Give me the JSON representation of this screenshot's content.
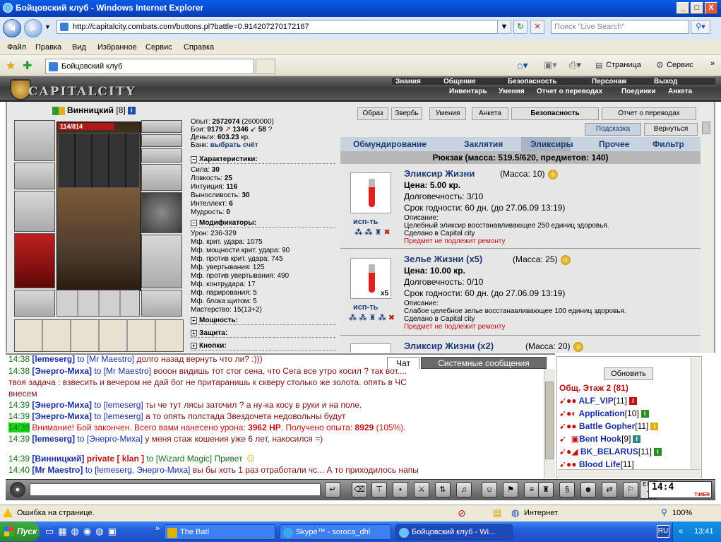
{
  "window": {
    "title": "Бойцовский клуб - Windows Internet Explorer",
    "min": "_",
    "max": "□",
    "close": "X"
  },
  "address": {
    "url": "http://capitalcity.combats.com/buttons.pl?battle=0.914207270172167",
    "search_placeholder": "Поиск \"Live Search\""
  },
  "menu": [
    "Файл",
    "Правка",
    "Вид",
    "Избранное",
    "Сервис",
    "Справка"
  ],
  "fav": {
    "tab": "Бойцовский клуб",
    "page": "Страница",
    "tools": "Сервис"
  },
  "game": {
    "logo": "CAPITALCITY",
    "nav_top": [
      "Знания",
      "Общение",
      "Безопасность",
      "Персонаж",
      "Выход"
    ],
    "nav_bottom": [
      "Инвентарь",
      "Умения",
      "Отчет о переводах",
      "Поединки",
      "Анкета"
    ]
  },
  "character": {
    "name": "Винницкий",
    "level": "[8]",
    "hp": "114/814",
    "info": [
      {
        "label": "Опыт:",
        "value": "2572074",
        "extra": "(2600000)"
      },
      {
        "label": "Бои:",
        "value": "9179",
        "extra": "1346",
        "extra2": "58"
      },
      {
        "label": "Деньги:",
        "value": "603.23",
        "extra": "кр."
      },
      {
        "label": "Банк:",
        "value": "выбрать счёт",
        "extra": ""
      }
    ],
    "sections": {
      "stats": "Характеристики:",
      "mods": "Модификаторы:",
      "power": "Мощность:",
      "defense": "Защита:",
      "buttons": "Кнопки:"
    },
    "stats": [
      {
        "label": "Сила:",
        "value": "30"
      },
      {
        "label": "Ловкость:",
        "value": "25"
      },
      {
        "label": "Интуиция:",
        "value": "116"
      },
      {
        "label": "Выносливость:",
        "value": "30"
      },
      {
        "label": "Интеллект:",
        "value": "6"
      },
      {
        "label": "Мудрость:",
        "value": "0"
      }
    ],
    "mods": [
      "Урон: 236-329",
      "Мф. крит. удара: 1075",
      "Мф. мощности крит. удара: 90",
      "Мф. против крит. удара: 745",
      "Мф. увертывания: 125",
      "Мф. против увертывания: 490",
      "Мф. контрудара: 17",
      "Мф. парирования: 5",
      "Мф. блока щитом: 5",
      "Мастерство: 15(13+2)"
    ]
  },
  "panel": {
    "top_buttons": [
      "Образ",
      "Звербь",
      "Умения",
      "Анкета",
      "Безопасность",
      "Отчет о переводах"
    ],
    "hint": "Подсказка",
    "back": "Вернуться",
    "tabs": [
      "Обмундирование",
      "Заклятия",
      "Эликсиры",
      "Прочее",
      "Фильтр"
    ],
    "backpack": "Рюкзак (масса: 519.5/620, предметов: 140)",
    "use_label": "исп-ть",
    "items": [
      {
        "name": "Эликсир Жизни",
        "mass": "(Масса: 10)",
        "price": "Цена: 5.00 кр.",
        "durability": "Долговечность: 3/10",
        "expiry": "Срок годности: 60 дн. (до 27.06.09 13:19)",
        "desc_label": "Описание:",
        "desc": "Целебный эликсир восстанавливающее 250 единиц здоровья.",
        "made": "Сделано в Capital city",
        "repair": "Предмет не подлежит ремонту",
        "count": ""
      },
      {
        "name": "Зелье Жизни (x5)",
        "mass": "(Масса: 25)",
        "price": "Цена: 10.00 кр.",
        "durability": "Долговечность: 0/10",
        "expiry": "Срок годности: 60 дн. (до 27.06.09 13:19)",
        "desc_label": "Описание:",
        "desc": "Слабое целебное зелье восстанавливающее 100 единиц здоровья.",
        "made": "Сделано в Capital city",
        "repair": "Предмет не подлежит ремонту",
        "count": "x5"
      },
      {
        "name": "Эликсир Жизни (x2)",
        "mass": "(Масса: 20)"
      }
    ]
  },
  "chat": {
    "tabs": [
      "Чат",
      "Системные сообщения"
    ],
    "lines": [
      {
        "time": "14:38",
        "nick": "[lemeserg]",
        "to": " to [Mr Maestro] ",
        "msg": "долго назад вернуть что ли? :)))"
      },
      {
        "time": "14:38",
        "nick": "[Энерго-Миха]",
        "to": " to [Mr Maestro] ",
        "msg": "вооон видишь тот стог сена, что Сега все утро косил ? так вот...."
      },
      {
        "cont": "твоя задача : взвесить и вечером не дай бог не притаранишь к скверу столько же золота. опять в ЧС"
      },
      {
        "cont": "внесем"
      },
      {
        "time": "14:39",
        "nick": "[Энерго-Миха]",
        "to": " to [lemeserg] ",
        "msg": "ты че тут лясы заточил ? а ну-ка косу в руки и на поле."
      },
      {
        "time": "14:39",
        "nick": "[Энерго-Миха]",
        "to": " to [lemeserg] ",
        "msg": "а то опять полстада Звездочета недовольны будут"
      },
      {
        "time": "14:39",
        "sys1": "Внимание!",
        "sys2": " Бой закончен. Всего вами нанесено урона: ",
        "b1": "3962 HP",
        "sys3": ". Получено опыта: ",
        "b2": "8929",
        "sys4": " (105%)."
      },
      {
        "time": "14:39",
        "nick": "[lemeserg]",
        "to": " to [Энерго-Миха] ",
        "msg": "у меня стаж кошения уже 6 лет, накосился =)"
      },
      {
        "time": "14:39",
        "nick": "[Винницкий]",
        "priv": " private [ klan ] ",
        "to": "to [Wizard Magic] ",
        "msg": "Привет"
      },
      {
        "time": "14:40",
        "nick": "[Mr Maestro]",
        "to": " to [lemeserg, Энерго-Миха] ",
        "msg": "вы бы хоть 1 раз отработали чс... А то приходилось напы"
      }
    ]
  },
  "online": {
    "refresh": "Обновить",
    "floor": "Общ. Этаж 2 (81)",
    "users": [
      {
        "name": "ALF_VIP",
        "level": "[11]"
      },
      {
        "name": "Application",
        "level": "[10]"
      },
      {
        "name": "Battle Gopher",
        "level": "[11]"
      },
      {
        "name": "Bent Hook",
        "level": "[9]"
      },
      {
        "name": "BK_BELARUS",
        "level": "[11]"
      },
      {
        "name": "Blood Life",
        "level": "[11]"
      }
    ]
  },
  "toolbar": {
    "clock": "14:4",
    "timer": "TIMER"
  },
  "statusbar": {
    "error": "Ошибка на странице.",
    "zone": "Интернет",
    "zoom": "100%"
  },
  "taskbar": {
    "start": "Пуск",
    "tasks": [
      "The Bat!",
      "Skype™ - soroca_dhl",
      "Бойцовский клуб - Wi..."
    ],
    "lang": "RU",
    "time": "13:41"
  },
  "colors": {
    "link": "#1c3a78",
    "chat_time": "#1a6e1a",
    "system": "#c01010"
  }
}
